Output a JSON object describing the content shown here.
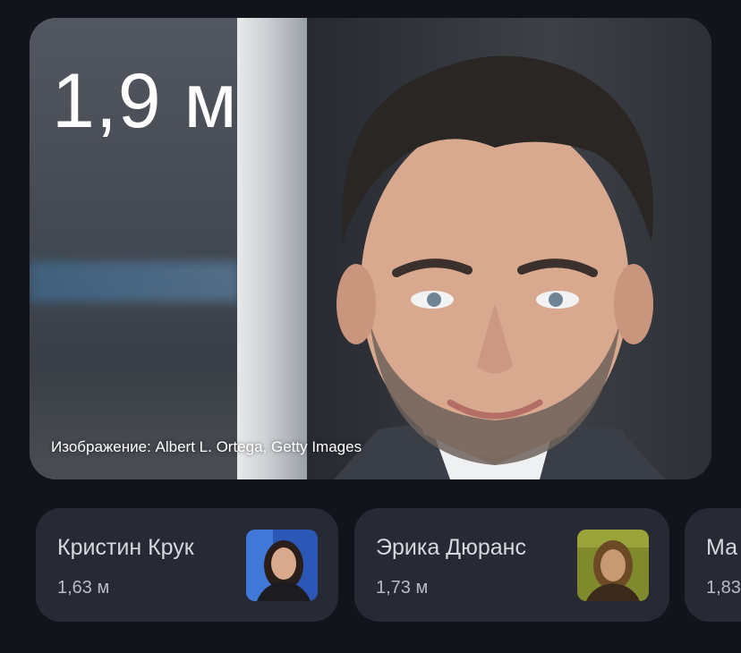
{
  "hero": {
    "height_value": "1,9 м",
    "photo_credit": "Изображение: Albert L. Ortega, Getty Images",
    "photo_icon": "portrait-photo"
  },
  "related": [
    {
      "name": "Кристин Крук",
      "height": "1,63 м",
      "thumb_icon": "person-thumbnail"
    },
    {
      "name": "Эрика Дюранс",
      "height": "1,73 м",
      "thumb_icon": "person-thumbnail"
    },
    {
      "name": "Ма",
      "height": "1,83",
      "thumb_icon": "person-thumbnail"
    }
  ],
  "colors": {
    "background": "#13141b",
    "chip_background": "#272935",
    "chip_text": "#d6d8dd"
  }
}
